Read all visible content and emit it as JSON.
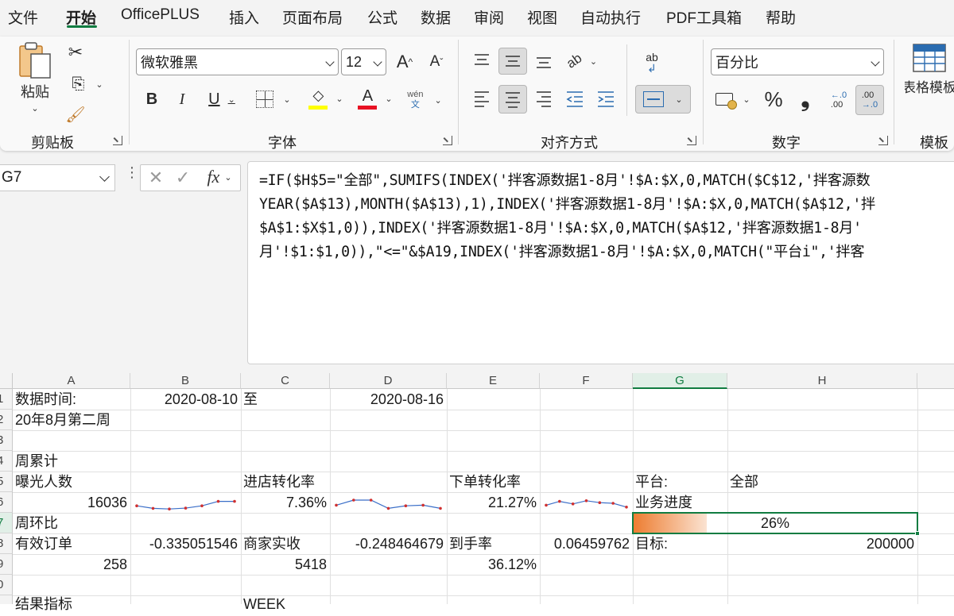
{
  "menu": {
    "items": [
      "文件",
      "开始",
      "OfficePLUS",
      "插入",
      "页面布局",
      "公式",
      "数据",
      "审阅",
      "视图",
      "自动执行",
      "PDF工具箱",
      "帮助"
    ],
    "active": "开始"
  },
  "ribbon": {
    "clipboard": {
      "paste_label": "粘贴",
      "group_label": "剪贴板"
    },
    "font": {
      "family": "微软雅黑",
      "size": "12",
      "group_label": "字体",
      "bold": "B",
      "italic": "I",
      "underline": "U",
      "grow": "A",
      "shrink": "A",
      "phonetic_top": "wén",
      "phonetic_bottom": "文",
      "highlight_color": "#ffff00",
      "font_color": "#e81123"
    },
    "alignment": {
      "group_label": "对齐方式",
      "wrap_text": "ab"
    },
    "number": {
      "format": "百分比",
      "group_label": "数字",
      "percent": "%",
      "comma": "❟",
      "inc_decimal": ".00",
      "dec_decimal": ".00"
    },
    "template": {
      "label": "表格模板",
      "group_label": "模板"
    }
  },
  "formula_bar": {
    "name_box": "G7",
    "fx": "fx",
    "lines": [
      "=IF($H$5=\"全部\",SUMIFS(INDEX('拌客源数据1-8月'!$A:$X,0,MATCH($C$12,'拌客源数",
      "YEAR($A$13),MONTH($A$13),1),INDEX('拌客源数据1-8月'!$A:$X,0,MATCH($A$12,'拌",
      "$A$1:$X$1,0)),INDEX('拌客源数据1-8月'!$A:$X,0,MATCH($A$12,'拌客源数据1-8月'",
      "月'!$1:$1,0)),\"<=\"&$A19,INDEX('拌客源数据1-8月'!$A:$X,0,MATCH(\"平台i\",'拌客"
    ]
  },
  "sheet": {
    "columns": [
      "A",
      "B",
      "C",
      "D",
      "E",
      "F",
      "G",
      "H"
    ],
    "selected_column": "G",
    "rows": [
      "1",
      "2",
      "3",
      "4",
      "5",
      "6",
      "7",
      "8",
      "9",
      "0",
      ""
    ],
    "selected_row": "7",
    "cells": {
      "A1": "数据时间:",
      "B1": "2020-08-10",
      "C1": "至",
      "D1": "2020-08-16",
      "A2": "20年8月第二周",
      "A4": "周累计",
      "A5": "曝光人数",
      "C5": "进店转化率",
      "E5": "下单转化率",
      "G5": "平台:",
      "H5": "全部",
      "A6": "16036",
      "C6": "7.36%",
      "E6": "21.27%",
      "G6": "业务进度",
      "A7": "周环比",
      "G7": "26%",
      "A8": "有效订单",
      "B8": "-0.335051546",
      "C8": "商家实收",
      "D8": "-0.248464679",
      "E8": "到手率",
      "F8": "0.06459762",
      "G8": "目标:",
      "H8": "200000",
      "A9": "258",
      "C9": "5418",
      "E9": "36.12%",
      "A11": "结果指标",
      "C11": "WEEK"
    },
    "progress": 0.26,
    "sparklines": {
      "exposure": [
        0.3,
        0.1,
        0.05,
        0.12,
        0.3,
        0.65,
        0.65
      ],
      "store_conversion": [
        0.35,
        0.75,
        0.75,
        0.1,
        0.3,
        0.35,
        0.1
      ],
      "order_conversion": [
        0.35,
        0.65,
        0.45,
        0.7,
        0.55,
        0.5,
        0.2
      ]
    }
  }
}
